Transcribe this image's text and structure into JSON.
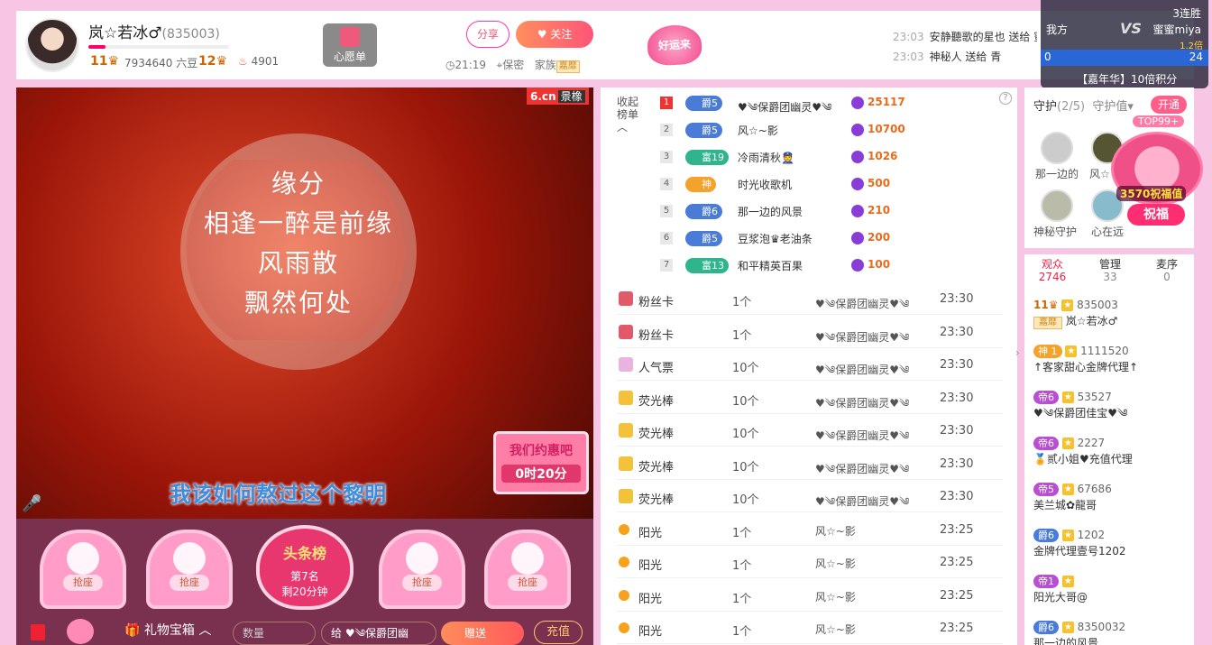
{
  "anchor": {
    "name": "岚☆若冰♂",
    "id": "(835003)",
    "level1": "11",
    "beans": "7934640 六豆",
    "level2": "12",
    "fire": "4901",
    "wish": "心愿单",
    "share": "分享",
    "follow": "关注",
    "time": "21:19",
    "location": "保密",
    "family": "家族",
    "family_tag": "嘉靡",
    "lucky": "好运来"
  },
  "broadcast": [
    {
      "time": "23:03",
      "text": "安静聽歌的星也 送给 蜜蜜miya 源化了 共鸣"
    },
    {
      "time": "23:03",
      "text": "神秘人 送给 青"
    }
  ],
  "pk": {
    "streak": "3连胜",
    "me": "我方",
    "opponent": "蜜蜜miya",
    "mult": "1.2倍",
    "left_score": "0",
    "right_score": "24",
    "bonus": "【嘉年华】10倍积分"
  },
  "video": {
    "logo": "6.cn",
    "logo_tag": "景橡",
    "poem": [
      "缘分",
      "相逢一醉是前缘",
      "风雨散",
      "飘然何处"
    ],
    "lyric": "我该如何熬过这个黎明",
    "date_text": "我们约惠吧",
    "date_time": "0时20分"
  },
  "seats": {
    "label": "抢座",
    "headline_title": "头条榜",
    "headline_rank": "第7名",
    "headline_remain": "剩20分钟"
  },
  "bottom": {
    "gift_box": "礼物宝箱",
    "qty_placeholder": "数量",
    "to": "给 ♥༄保爵团幽",
    "send": "赠送",
    "recharge": "充值"
  },
  "ranking": {
    "collapse": "收起榜单",
    "rows": [
      {
        "no": "1",
        "badge": "爵5",
        "badge_type": "duke",
        "name": "♥༄保爵团幽灵♥༄",
        "score": "25117"
      },
      {
        "no": "2",
        "badge": "爵5",
        "badge_type": "duke",
        "name": "风☆~影",
        "score": "10700"
      },
      {
        "no": "3",
        "badge": "富19",
        "badge_type": "rich",
        "name": "冷雨清秋👮",
        "score": "1026"
      },
      {
        "no": "4",
        "badge": "神",
        "badge_type": "god",
        "name": "时光收歌机",
        "score": "500"
      },
      {
        "no": "5",
        "badge": "爵6",
        "badge_type": "duke",
        "name": "那一边的风景",
        "score": "210"
      },
      {
        "no": "6",
        "badge": "爵5",
        "badge_type": "duke",
        "name": "豆浆泡♛老油条",
        "score": "200"
      },
      {
        "no": "7",
        "badge": "富13",
        "badge_type": "rich",
        "name": "和平精英百果",
        "score": "100"
      }
    ]
  },
  "gifts": [
    {
      "name": "粉丝卡",
      "qty": "1个",
      "user": "♥༄保爵团幽灵♥༄",
      "time": "23:30",
      "color": "#e05a6a"
    },
    {
      "name": "粉丝卡",
      "qty": "1个",
      "user": "♥༄保爵团幽灵♥༄",
      "time": "23:30",
      "color": "#e05a6a"
    },
    {
      "name": "人气票",
      "qty": "10个",
      "user": "♥༄保爵团幽灵♥༄",
      "time": "23:30",
      "color": "#e9b3e0"
    },
    {
      "name": "荧光棒",
      "qty": "10个",
      "user": "♥༄保爵团幽灵♥༄",
      "time": "23:30",
      "color": "#f3c23a"
    },
    {
      "name": "荧光棒",
      "qty": "10个",
      "user": "♥༄保爵团幽灵♥༄",
      "time": "23:30",
      "color": "#f3c23a"
    },
    {
      "name": "荧光棒",
      "qty": "10个",
      "user": "♥༄保爵团幽灵♥༄",
      "time": "23:30",
      "color": "#f3c23a"
    },
    {
      "name": "荧光棒",
      "qty": "10个",
      "user": "♥༄保爵团幽灵♥༄",
      "time": "23:30",
      "color": "#f3c23a"
    },
    {
      "name": "阳光",
      "qty": "1个",
      "user": "风☆~影",
      "time": "23:25",
      "color": "#f6a21c"
    },
    {
      "name": "阳光",
      "qty": "1个",
      "user": "风☆~影",
      "time": "23:25",
      "color": "#f6a21c"
    },
    {
      "name": "阳光",
      "qty": "1个",
      "user": "风☆~影",
      "time": "23:25",
      "color": "#f6a21c"
    },
    {
      "name": "阳光",
      "qty": "1个",
      "user": "风☆~影",
      "time": "23:25",
      "color": "#f6a21c"
    }
  ],
  "guard": {
    "tab1": "守护",
    "count": "(2/5)",
    "tab2": "守护值",
    "open": "开通",
    "top99": "TOP99+",
    "bless_value": "3570祝福值",
    "bless_btn": "祝福",
    "members": [
      "那一边的",
      "风☆",
      "神秘守护",
      "心在远"
    ]
  },
  "audience": {
    "tabs": [
      {
        "label": "观众",
        "count": "2746"
      },
      {
        "label": "管理",
        "count": "33"
      },
      {
        "label": "麦序",
        "count": "0"
      }
    ],
    "rows": [
      {
        "tag": "11",
        "id": "835003",
        "family": "嘉靡",
        "name": "岚☆若冰♂"
      },
      {
        "tag": "神 1",
        "id": "1111520",
        "name": "↑客家甜心金牌代理↑"
      },
      {
        "tag": "帝6",
        "id": "53527",
        "name": "♥༄保爵团佳宝♥༄"
      },
      {
        "tag": "帝6",
        "id": "2227",
        "name": "🏅贰小姐♥充值代理"
      },
      {
        "tag": "帝5",
        "id": "67686",
        "name": "美兰城✿龍哥"
      },
      {
        "tag": "爵6",
        "id": "1202",
        "name": "金牌代理壹号1202"
      },
      {
        "tag": "帝1",
        "id": "",
        "name": "阳光大哥@"
      },
      {
        "tag": "爵6",
        "id": "8350032",
        "name": "那一边的风景"
      }
    ]
  }
}
